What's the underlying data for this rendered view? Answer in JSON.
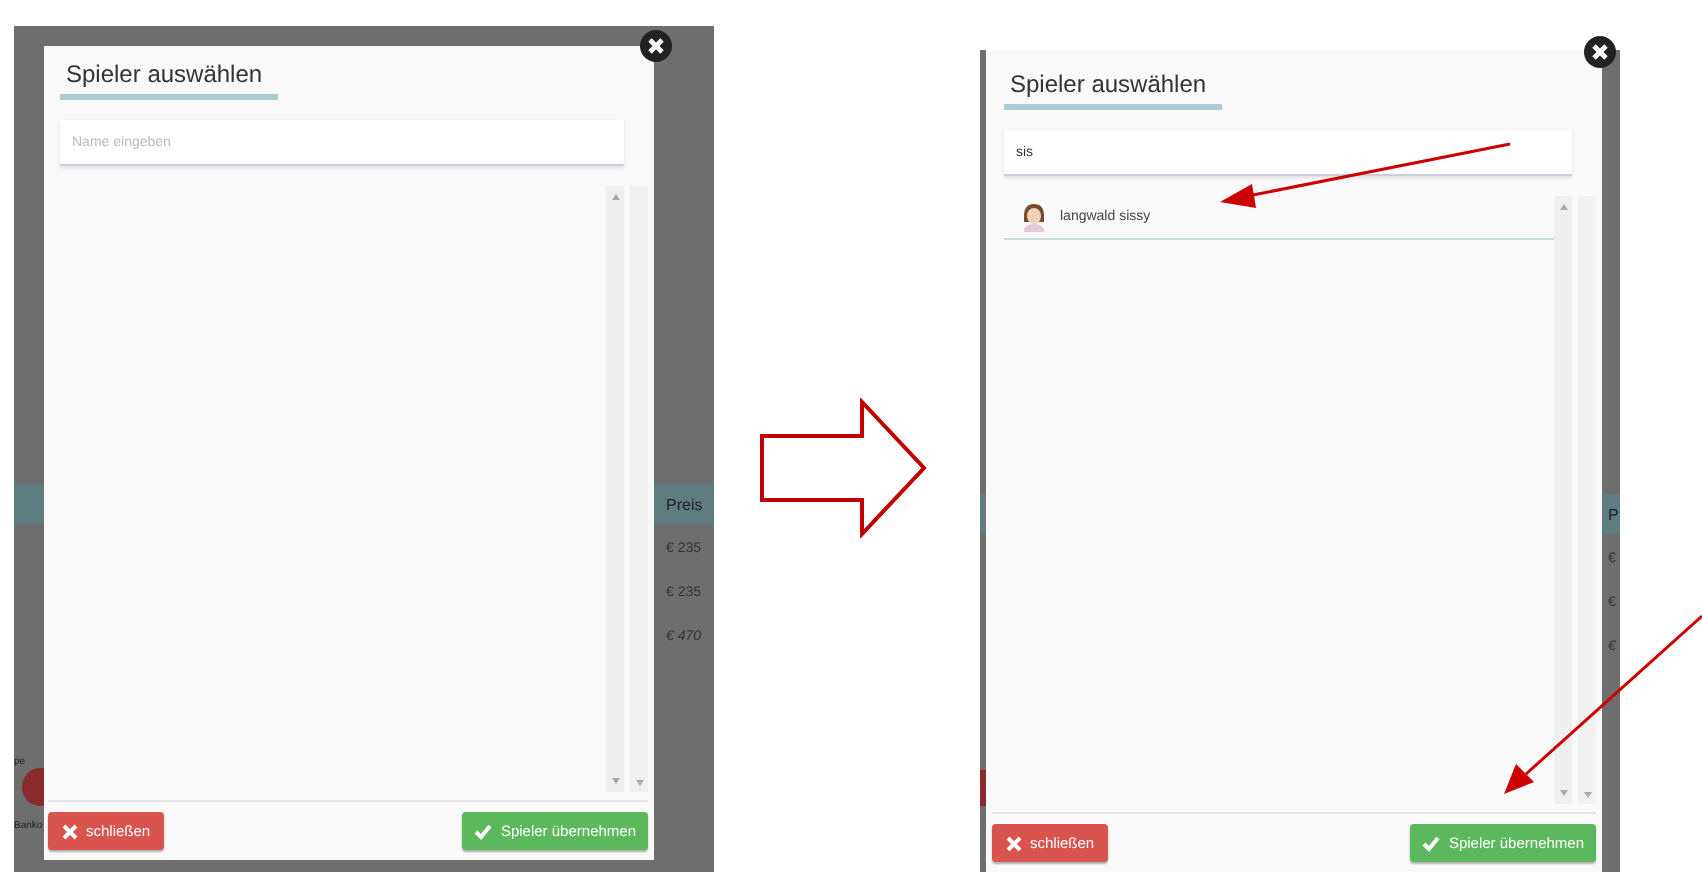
{
  "panels": [
    {
      "background": {
        "column_header": "Preis",
        "cells": [
          "€ 235",
          "€ 235",
          "€ 470"
        ],
        "fragments": [
          "pe",
          "Banko"
        ]
      },
      "dialog": {
        "title": "Spieler auswählen",
        "search": {
          "placeholder": "Name eingeben"
        },
        "buttons": [
          {
            "label": "schließen",
            "kind": "danger"
          },
          {
            "label": "Spieler übernehmen",
            "kind": "primary"
          }
        ]
      }
    },
    {
      "background": {
        "column_header": "P",
        "cells": [
          "€",
          "€",
          "€"
        ]
      },
      "dialog": {
        "title": "Spieler auswählen",
        "search": {
          "value": "sis"
        },
        "results": [
          {
            "name": "langwald sissy"
          }
        ],
        "buttons": [
          {
            "label": "schließen",
            "kind": "danger"
          },
          {
            "label": "Spieler übernehmen",
            "kind": "primary"
          }
        ]
      }
    }
  ]
}
